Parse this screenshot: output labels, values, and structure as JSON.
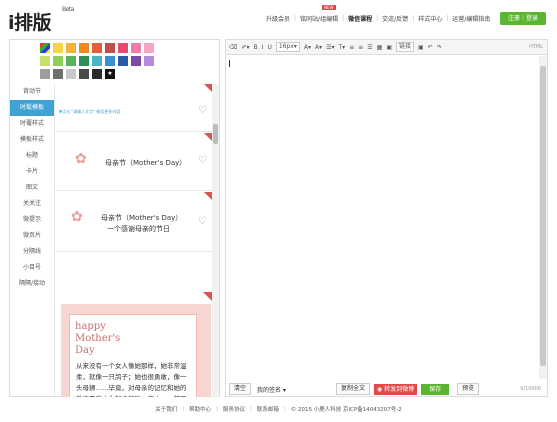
{
  "header": {
    "logo": "i排版",
    "beta": "Beta",
    "nav": [
      "升级会员",
      "铭同站/组编辑",
      "微信课程",
      "交流/反馈",
      "样式中心",
      "运营/编辑指南"
    ],
    "new_badge": "NEW",
    "login_label": "注册｜登录"
  },
  "palette": {
    "rows": [
      [
        "multi",
        "#f5d547",
        "#f2b237",
        "#ee8a1e",
        "#e45d3b",
        "#c0504d",
        "#e34c6b",
        "#f07aa9",
        "#f5a3c5"
      ],
      [
        "#c5e36a",
        "#8fce5a",
        "#59b35c",
        "#2f8e5a",
        "#4ab3c7",
        "#3b8fd0",
        "#2b5ba8",
        "#7b4aa8",
        "#b38ad9"
      ],
      [
        "#9d9d9d",
        "#6f6f6f",
        "#c9c9c9",
        "#4a4a4a",
        "#2a2a2a",
        "star"
      ]
    ]
  },
  "sidenav": [
    "背动节",
    "时髦模板",
    "时覆样式",
    "模板样式",
    "标题",
    "卡片",
    "图文",
    "关关注",
    "微提示",
    "微页片",
    "分隔线",
    "小目号",
    "隔隔/接动"
  ],
  "sidenav_active_index": 1,
  "cards": {
    "c1_text": "▼点击 \"请输入文字\" 微信更多内容",
    "c2_title": "母亲节（Mother's Day）",
    "c3_title": "母亲节（Mother's Day）",
    "c3_sub": "一个感谢母亲的节日",
    "big_title1": "happy",
    "big_title2": "Mother's",
    "big_title3": "Day",
    "big_body": "从来没有一个女人像她那样，她非常温柔，就像一只鸽子；她也很勇敢，像一头母狮……毕竟，对母亲的记忆和她的教诲是我人生起步的唯一资本……其要完了她"
  },
  "toolbar": [
    "⌫",
    "✐▾",
    "B",
    "I",
    "U",
    "16px▾",
    "A▾",
    "A▾",
    "☰▾",
    "T▾",
    "≡",
    "≡",
    "☰",
    "▦",
    "▣",
    "链接",
    "▣",
    "↶",
    "↷",
    "HTML"
  ],
  "bottombar": {
    "clear": "清空",
    "signature": "我的签名",
    "copy": "复制全文",
    "weibo": "转发到微博",
    "save": "保存",
    "preview": "预览",
    "count": "0/10000"
  },
  "footer": [
    "关于我们",
    "帮助中心",
    "服务协议",
    "联系邮箱",
    "© 2015 小鹿人科技  京ICP备14043207号-2"
  ]
}
